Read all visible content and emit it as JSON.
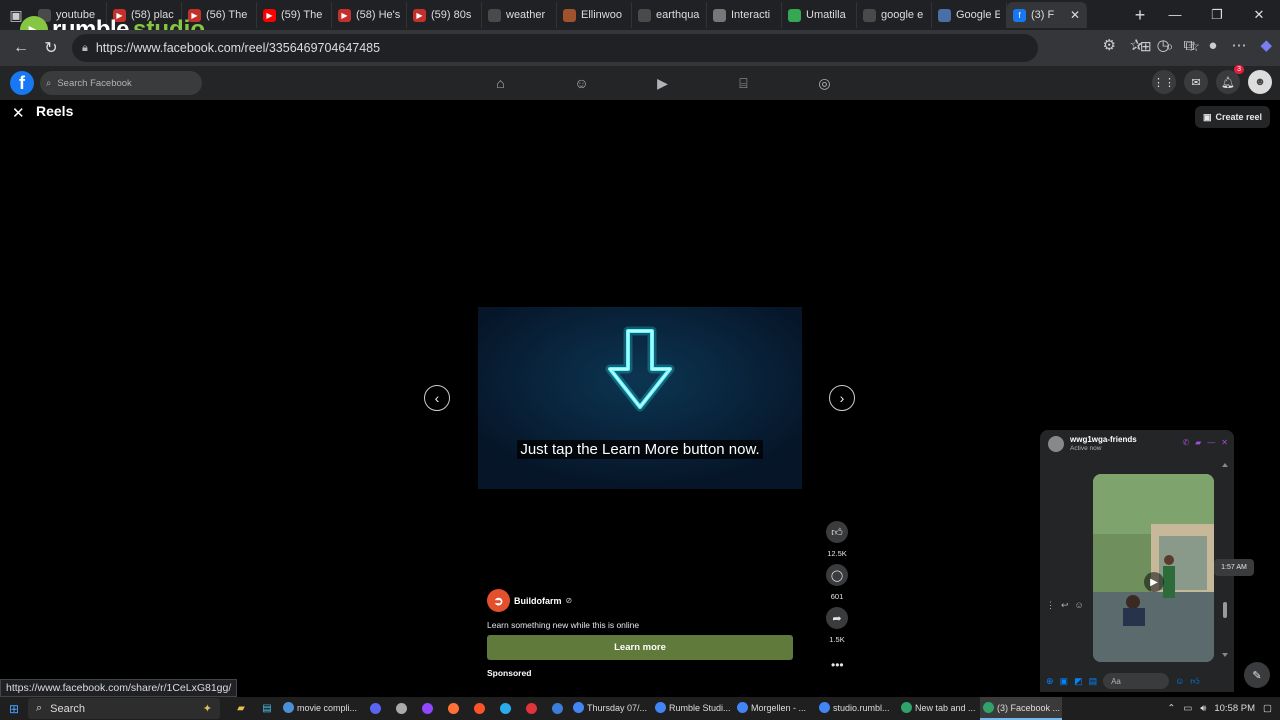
{
  "browser": {
    "tabs": [
      {
        "label": "youtube",
        "icon": "search-icon",
        "color": "#4a4a4a"
      },
      {
        "label": "(58) plac",
        "icon": "youtube-icon",
        "color": "#c4302b"
      },
      {
        "label": "(56) The",
        "icon": "youtube-icon",
        "color": "#c4302b"
      },
      {
        "label": "(59) The",
        "icon": "youtube-icon",
        "color": "#ff0000"
      },
      {
        "label": "(58) He's",
        "icon": "youtube-icon",
        "color": "#c4302b"
      },
      {
        "label": "(59) 80s",
        "icon": "youtube-icon",
        "color": "#c4302b"
      },
      {
        "label": "weather",
        "icon": "search-icon",
        "color": "#4a4a4a"
      },
      {
        "label": "Ellinwoo",
        "icon": "site-icon",
        "color": "#a0522d"
      },
      {
        "label": "earthqua",
        "icon": "search-icon",
        "color": "#4a4a4a"
      },
      {
        "label": "Interacti",
        "icon": "site-icon",
        "color": "#777777"
      },
      {
        "label": "Umatilla",
        "icon": "maps-icon",
        "color": "#34a853"
      },
      {
        "label": "google e",
        "icon": "search-icon",
        "color": "#4a4a4a"
      },
      {
        "label": "Google E",
        "icon": "earth-icon",
        "color": "#4a6fa5"
      },
      {
        "label": "(3) F",
        "icon": "facebook-icon",
        "color": "#1877f2",
        "active": true
      }
    ],
    "url": "https://www.facebook.com/reel/3356469704647485",
    "status_url": "https://www.facebook.com/share/r/1CeLxG81gg/"
  },
  "rumble": {
    "word": "rumble",
    "studio": "studio"
  },
  "facebook": {
    "search_placeholder": "Search Facebook",
    "notification_count": "3",
    "page_title": "Reels",
    "create_reel": "Create reel"
  },
  "reel": {
    "caption": "Just tap the Learn More button now.",
    "likes": "12.5K",
    "comments": "601",
    "shares": "1.5K",
    "author": "Buildofarm",
    "description": "Learn something new while this is online",
    "learn_more": "Learn more",
    "sponsored": "Sponsored"
  },
  "chat": {
    "name": "wwg1wga-friends",
    "status": "Active now",
    "input_placeholder": "Aa",
    "time_tooltip": "1:57 AM"
  },
  "taskbar": {
    "search_label": "Search",
    "apps": [
      {
        "label": "movie compli...",
        "color": "#4a90d9"
      },
      {
        "label": "Thursday 07/...",
        "color": "#4285f4"
      },
      {
        "label": "Rumble Studi...",
        "color": "#4285f4"
      },
      {
        "label": "Morgellen - ...",
        "color": "#4285f4"
      },
      {
        "label": "studio.rumbl...",
        "color": "#4285f4"
      },
      {
        "label": "New tab and ...",
        "color": "#2ea36b"
      },
      {
        "label": "(3) Facebook ...",
        "color": "#2ea36b",
        "active": true
      }
    ],
    "clock": "10:58 PM"
  }
}
